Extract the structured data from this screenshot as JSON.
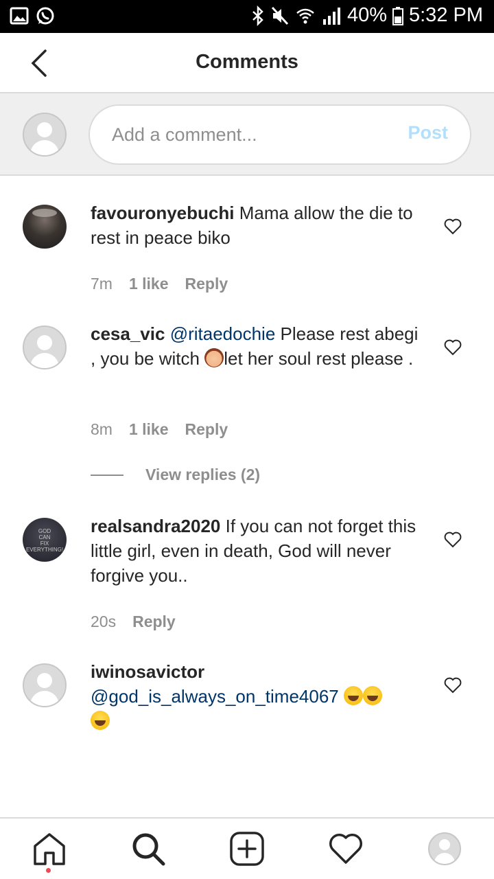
{
  "status_bar": {
    "battery": "40%",
    "time": "5:32 PM",
    "left_icons": [
      "gallery-icon",
      "whatsapp-icon"
    ],
    "right_icons": [
      "bluetooth-icon",
      "mute-icon",
      "wifi-icon",
      "signal-icon",
      "battery-icon"
    ]
  },
  "header": {
    "title": "Comments",
    "back_icon": "chevron-left-icon"
  },
  "composer": {
    "placeholder": "Add a comment...",
    "post_label": "Post",
    "post_color": "#b2dffc"
  },
  "comments": [
    {
      "username": "favouronyebuchi",
      "text": "Mama allow the die to rest in peace biko",
      "time": "7m",
      "likes": "1 like",
      "reply": "Reply"
    },
    {
      "username": "cesa_vic",
      "mention": "@ritaedochie",
      "text_before_emoji": " Please rest abegi , you be witch ",
      "emoji": "woman-gesturing-emoji",
      "text_after_emoji": "let her soul rest please .",
      "time": "8m",
      "likes": "1 like",
      "reply": "Reply",
      "view_replies": "View replies (2)"
    },
    {
      "username": "realsandra2020",
      "avatar_text": [
        "GOD",
        "CAN",
        "FIX",
        "EVERYTHING!"
      ],
      "text": "If you can not forget this little girl, even in death, God will never forgive you..",
      "time": "20s",
      "reply": "Reply"
    },
    {
      "username": "iwinosavictor",
      "mention": "@god_is_always_on_time4067",
      "emoji": "laughing-tears-emoji"
    }
  ],
  "bottom_nav": {
    "items": [
      "home-icon",
      "search-icon",
      "add-post-icon",
      "activity-heart-icon",
      "profile-avatar"
    ],
    "accent": "#ed4956"
  }
}
